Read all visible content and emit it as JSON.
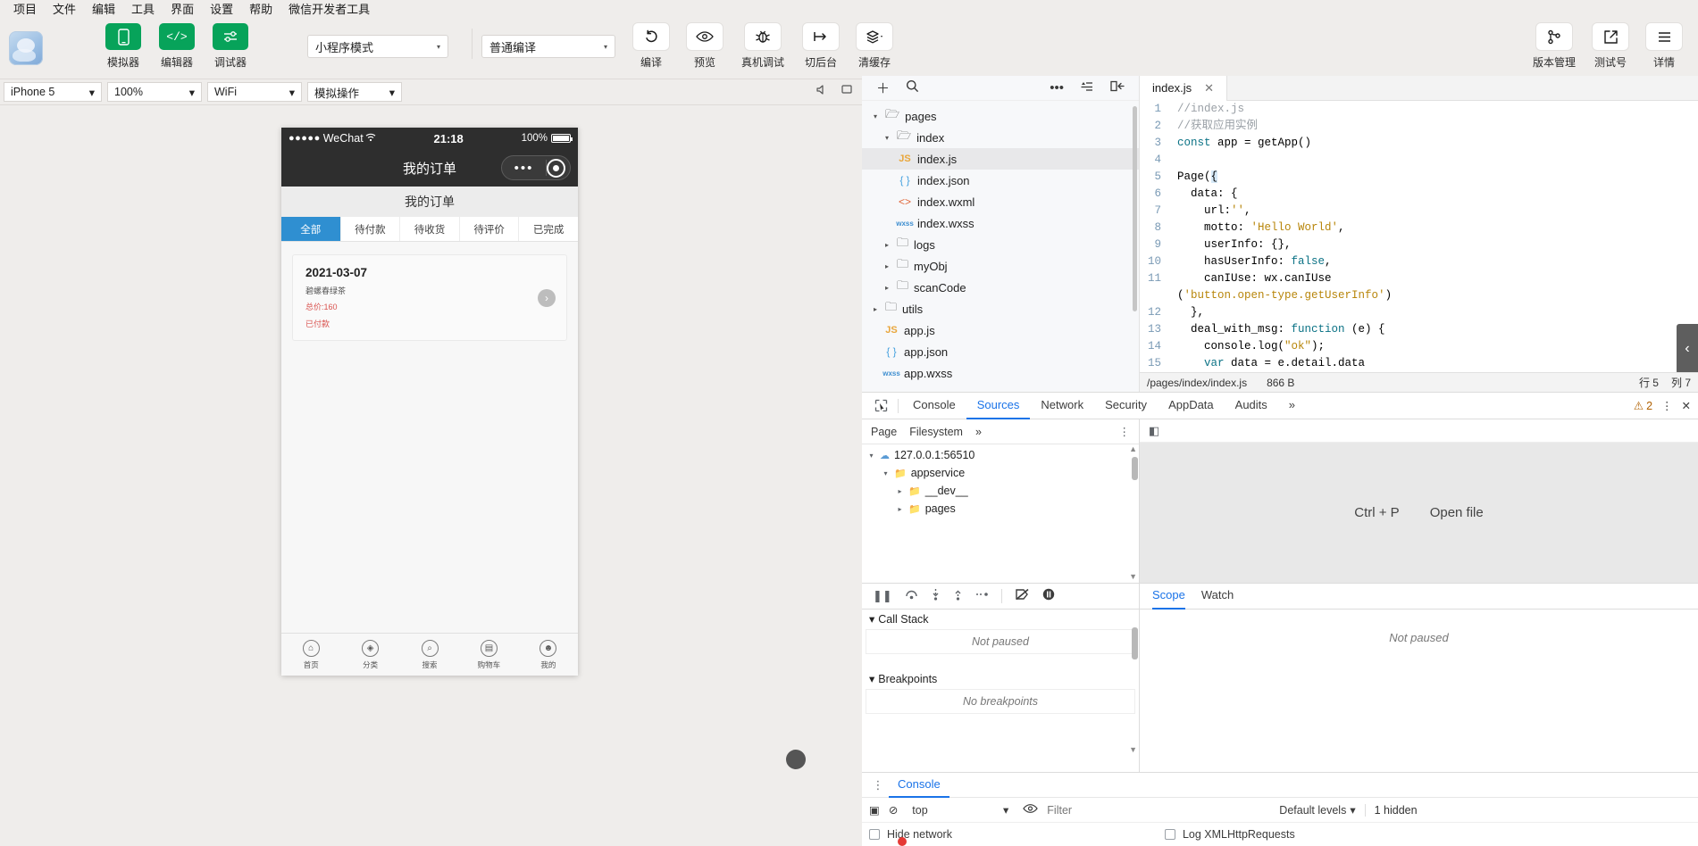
{
  "menubar": {
    "items": [
      "项目",
      "文件",
      "编辑",
      "工具",
      "界面",
      "设置",
      "帮助",
      "微信开发者工具"
    ]
  },
  "toolbar": {
    "left_buttons": [
      {
        "label": "模拟器",
        "icon": "phone-icon"
      },
      {
        "label": "编辑器",
        "icon": "code-icon"
      },
      {
        "label": "调试器",
        "icon": "debug-sliders-icon"
      }
    ],
    "mode_select": {
      "value": "小程序模式",
      "caret": "▾"
    },
    "compile_select": {
      "value": "普通编译",
      "caret": "▾"
    },
    "actions": [
      {
        "label": "编译",
        "icon": "refresh-icon"
      },
      {
        "label": "预览",
        "icon": "eye-icon"
      },
      {
        "label": "真机调试",
        "icon": "bug-icon"
      },
      {
        "label": "切后台",
        "icon": "background-icon"
      },
      {
        "label": "清缓存",
        "icon": "layers-icon"
      }
    ],
    "right_actions": [
      {
        "label": "版本管理",
        "icon": "git-branch-icon"
      },
      {
        "label": "测试号",
        "icon": "external-link-icon"
      },
      {
        "label": "详情",
        "icon": "hamburger-icon"
      }
    ]
  },
  "simbar": {
    "device": "iPhone 5",
    "zoom": "100%",
    "network": "WiFi",
    "action": "模拟操作",
    "caret": "▾",
    "icons": [
      "volume-icon",
      "rotate-screen-icon"
    ]
  },
  "phone": {
    "status": {
      "dots": "●●●●●",
      "carrier": "WeChat",
      "wifi": "wifi-icon",
      "time": "21:18",
      "battery": "100%"
    },
    "nav_title": "我的订单",
    "capsule": {
      "more": "•••",
      "close": "target-icon"
    },
    "page_title": "我的订单",
    "tabs": [
      {
        "label": "全部",
        "active": true
      },
      {
        "label": "待付款",
        "active": false
      },
      {
        "label": "待收货",
        "active": false
      },
      {
        "label": "待评价",
        "active": false
      },
      {
        "label": "已完成",
        "active": false
      }
    ],
    "order": {
      "date": "2021-03-07",
      "product": "碧螺春绿茶",
      "price": "总价:160",
      "status": "已付款",
      "arrow": "›"
    },
    "tabbar": [
      {
        "label": "首页",
        "icon": "home-icon",
        "glyph": "⌂"
      },
      {
        "label": "分类",
        "icon": "category-icon",
        "glyph": "◈"
      },
      {
        "label": "搜索",
        "icon": "search-icon",
        "glyph": "⌕"
      },
      {
        "label": "购物车",
        "icon": "cart-icon",
        "glyph": "▤"
      },
      {
        "label": "我的",
        "icon": "user-icon",
        "glyph": "☻"
      }
    ]
  },
  "filetree": {
    "toolbar_icons": [
      "add-icon",
      "search-icon",
      "more-icon",
      "collapse-list-icon",
      "panel-toggle-icon"
    ],
    "nodes": [
      {
        "label": "pages",
        "indent": 0,
        "twisty": "▾",
        "icon": "folder-open-icon",
        "selected": false
      },
      {
        "label": "index",
        "indent": 1,
        "twisty": "▾",
        "icon": "folder-open-icon",
        "selected": false
      },
      {
        "label": "index.js",
        "indent": 2,
        "twisty": "",
        "icon": "js-icon",
        "selected": true
      },
      {
        "label": "index.json",
        "indent": 2,
        "twisty": "",
        "icon": "json-icon",
        "selected": false
      },
      {
        "label": "index.wxml",
        "indent": 2,
        "twisty": "",
        "icon": "wxml-icon",
        "selected": false
      },
      {
        "label": "index.wxss",
        "indent": 2,
        "twisty": "",
        "icon": "wxss-icon",
        "selected": false
      },
      {
        "label": "logs",
        "indent": 1,
        "twisty": "▸",
        "icon": "folder-icon",
        "selected": false
      },
      {
        "label": "myObj",
        "indent": 1,
        "twisty": "▸",
        "icon": "folder-icon",
        "selected": false
      },
      {
        "label": "scanCode",
        "indent": 1,
        "twisty": "▸",
        "icon": "folder-icon",
        "selected": false
      },
      {
        "label": "utils",
        "indent": 0,
        "twisty": "▸",
        "icon": "folder-icon",
        "selected": false
      },
      {
        "label": "app.js",
        "indent": 0,
        "twisty": "",
        "icon": "js-icon",
        "selected": false
      },
      {
        "label": "app.json",
        "indent": 0,
        "twisty": "",
        "icon": "json-icon",
        "selected": false
      },
      {
        "label": "app.wxss",
        "indent": 0,
        "twisty": "",
        "icon": "wxss-icon",
        "selected": false
      }
    ]
  },
  "editor": {
    "tab": {
      "label": "index.js",
      "close": "✕"
    },
    "lines": [
      {
        "n": "1",
        "html": "<span class='k-com'>//index.js</span>"
      },
      {
        "n": "2",
        "html": "<span class='k-com'>//获取应用实例</span>"
      },
      {
        "n": "3",
        "html": "<span class='k-kw'>const</span> app = getApp()"
      },
      {
        "n": "4",
        "html": ""
      },
      {
        "n": "5",
        "html": "Page({"
      },
      {
        "n": "6",
        "html": "  data: {"
      },
      {
        "n": "7",
        "html": "    url:<span class='k-str'>''</span>,"
      },
      {
        "n": "8",
        "html": "    motto: <span class='k-str'>'Hello World'</span>,"
      },
      {
        "n": "9",
        "html": "    userInfo: {},"
      },
      {
        "n": "10",
        "html": "    hasUserInfo: <span class='k-bool'>false</span>,"
      },
      {
        "n": "11",
        "html": "    canIUse: wx.canIUse"
      },
      {
        "n": "",
        "html": "(<span class='k-str'>'button.open-type.getUserInfo'</span>)"
      },
      {
        "n": "12",
        "html": "  },"
      },
      {
        "n": "13",
        "html": "  deal_with_msg: <span class='k-fn'>function</span> (e) {"
      },
      {
        "n": "14",
        "html": "    console.log(<span class='k-str'>\"ok\"</span>);"
      },
      {
        "n": "15",
        "html": "    <span class='k-kw'>var</span> data = e.detail.data"
      }
    ],
    "status": {
      "path": "/pages/index/index.js",
      "size": "866 B",
      "line": "行 5",
      "col": "列 7"
    },
    "collapse_icon": "‹"
  },
  "devtools": {
    "tabs": [
      {
        "label": "Console",
        "active": false
      },
      {
        "label": "Sources",
        "active": true
      },
      {
        "label": "Network",
        "active": false
      },
      {
        "label": "Security",
        "active": false
      },
      {
        "label": "AppData",
        "active": false
      },
      {
        "label": "Audits",
        "active": false
      },
      {
        "label": "»",
        "active": false
      }
    ],
    "inspect_icon": "cursor-inspect-icon",
    "warnings": "2",
    "warn_icon": "⚠",
    "kebab_icon": "⋮",
    "sources": {
      "subtabs": [
        "Page",
        "Filesystem",
        "»"
      ],
      "kebab": "⋮",
      "panel_toggle": "◧",
      "tree": [
        {
          "label": "127.0.0.1:56510",
          "indent": 0,
          "twisty": "▾",
          "icon": "cloud-icon"
        },
        {
          "label": "appservice",
          "indent": 1,
          "twisty": "▾",
          "icon": "folder-icon"
        },
        {
          "label": "__dev__",
          "indent": 2,
          "twisty": "▸",
          "icon": "folder-icon"
        },
        {
          "label": "pages",
          "indent": 2,
          "twisty": "▸",
          "icon": "folder-icon"
        }
      ],
      "empty_hint": {
        "shortcut": "Ctrl + P",
        "text": "Open file"
      }
    },
    "debugger": {
      "controls": [
        "pause-icon",
        "step-over-icon",
        "step-into-icon",
        "step-out-icon",
        "step-icon",
        "deactivate-breakpoints-icon",
        "pause-on-exceptions-icon"
      ],
      "tabs": [
        {
          "label": "Scope",
          "active": true
        },
        {
          "label": "Watch",
          "active": false
        }
      ],
      "sections": [
        {
          "title": "Call Stack",
          "body": "Not paused"
        },
        {
          "title": "Breakpoints",
          "body": "No breakpoints"
        }
      ],
      "scope_body": "Not paused",
      "twisty": "▾"
    },
    "console_drawer": {
      "kebab": "⋮",
      "tabs": [
        {
          "label": "Console",
          "active": true
        }
      ],
      "toolbar": {
        "drawer_icon": "▣",
        "clear_icon": "⊘",
        "context": "top",
        "caret": "▾",
        "eye_icon": "👁",
        "filter_placeholder": "Filter",
        "levels": "Default levels",
        "levels_caret": "▾",
        "hidden": "1 hidden"
      },
      "options": [
        {
          "label": "Hide network",
          "checked": false
        },
        {
          "label": "Log XMLHttpRequests",
          "checked": false
        }
      ]
    }
  }
}
